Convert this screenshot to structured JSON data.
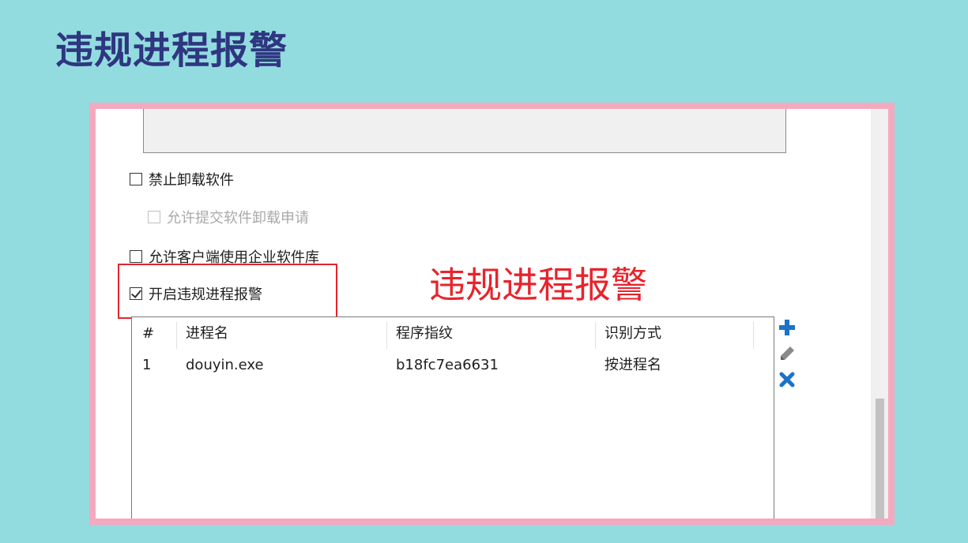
{
  "slide": {
    "title": "违规进程报警"
  },
  "options": {
    "disable_uninstall": {
      "label": "禁止卸载软件",
      "checked": false
    },
    "allow_uninstall_request": {
      "label": "允许提交软件卸载申请",
      "checked": false,
      "disabled": true
    },
    "allow_software_library": {
      "label": "允许客户端使用企业软件库",
      "checked": false
    },
    "enable_violation_alert": {
      "label": "开启违规进程报警",
      "checked": true
    }
  },
  "annotation": {
    "text": "违规进程报警"
  },
  "table": {
    "columns": [
      "#",
      "进程名",
      "程序指纹",
      "识别方式"
    ],
    "rows": [
      {
        "index": "1",
        "process": "douyin.exe",
        "fingerprint": "b18fc7ea6631",
        "method": "按进程名"
      }
    ]
  },
  "icons": {
    "add": "plus-icon",
    "edit": "pencil-icon",
    "delete": "close-icon"
  },
  "colors": {
    "background": "#92dcdf",
    "title": "#2f3680",
    "frame": "#f4a9bf",
    "annotation": "#e8232c",
    "tool_icon": "#1b72c8"
  }
}
